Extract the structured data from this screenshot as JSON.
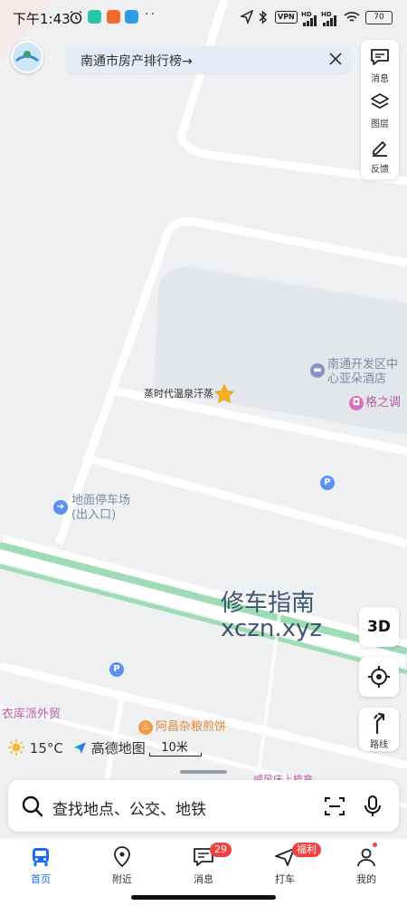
{
  "status_bar": {
    "time": "下午1:43",
    "vpn": "VPN",
    "signal_1": "HD",
    "signal_2": "HD",
    "battery": "70"
  },
  "banner": {
    "text": "南通市房产排行榜→"
  },
  "tools": {
    "message_label": "消息",
    "layers_label": "图层",
    "feedback_label": "反馈"
  },
  "map": {
    "pois": [
      {
        "name": "蒸时代温泉汗蒸"
      },
      {
        "name_line1": "南通开发区中",
        "name_line2": "心亚朵酒店"
      },
      {
        "name": "格之调"
      },
      {
        "name_line1": "地面停车场",
        "name_line2": "(出入口)"
      },
      {
        "name": "衣库派外贸"
      },
      {
        "name": "阿昌杂粮煎饼"
      },
      {
        "name": "威风床上植章"
      }
    ],
    "parking_symbol": "P",
    "watermark_line1": "修车指南",
    "watermark_line2": "xczn.xyz"
  },
  "controls": {
    "btn_3d": "3D",
    "route_label": "路线"
  },
  "weather": {
    "temperature": "15°C"
  },
  "brand": {
    "name": "高德地图"
  },
  "scale": {
    "label": "10米"
  },
  "search": {
    "placeholder": "查找地点、公交、地铁"
  },
  "nav": {
    "items": [
      {
        "label": "首页"
      },
      {
        "label": "附近"
      },
      {
        "label": "消息",
        "badge": "29"
      },
      {
        "label": "打车",
        "badge": "福利"
      },
      {
        "label": "我的"
      }
    ]
  },
  "colors": {
    "accent": "#1a6cf2",
    "badge": "#f04141",
    "map_bg": "#eef0f2",
    "road_green": "#9fdcb5"
  }
}
